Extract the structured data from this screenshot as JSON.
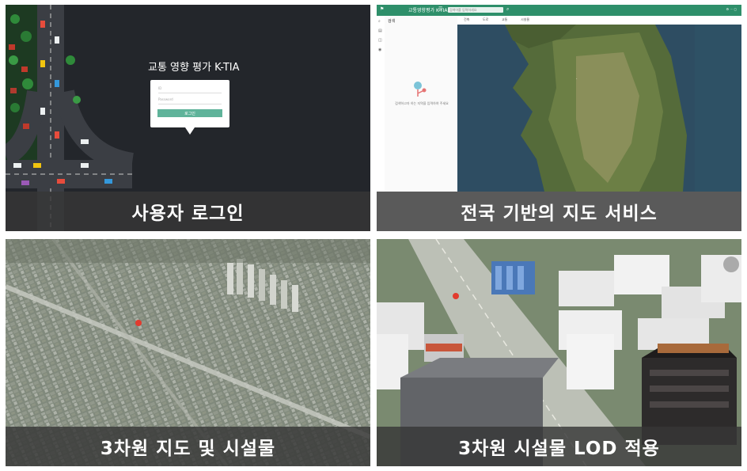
{
  "panels": [
    {
      "caption": "사용자 로그인",
      "login": {
        "title": "교통 영향 평가 K-TIA",
        "id_placeholder": "ID",
        "pw_placeholder": "Password",
        "button": "로그인"
      }
    },
    {
      "caption": "전국 기반의 지도 서비스",
      "app": {
        "title": "교통영향평가 K-TIA",
        "search_placeholder": "검색어를 입력하세요",
        "tabs": [
          "건축",
          "도로",
          "교통",
          "시설물"
        ],
        "panel_title": "검색",
        "empty_message": "검색하고자 하는 지역을 입력하여 주세요"
      }
    },
    {
      "caption": "3차원 지도 및 시설물"
    },
    {
      "caption": "3차원 시설물 LOD 적용"
    }
  ],
  "colors": {
    "accent": "#2e8f6a",
    "caption_bg": "#373737",
    "login_button": "#5fb39a"
  }
}
